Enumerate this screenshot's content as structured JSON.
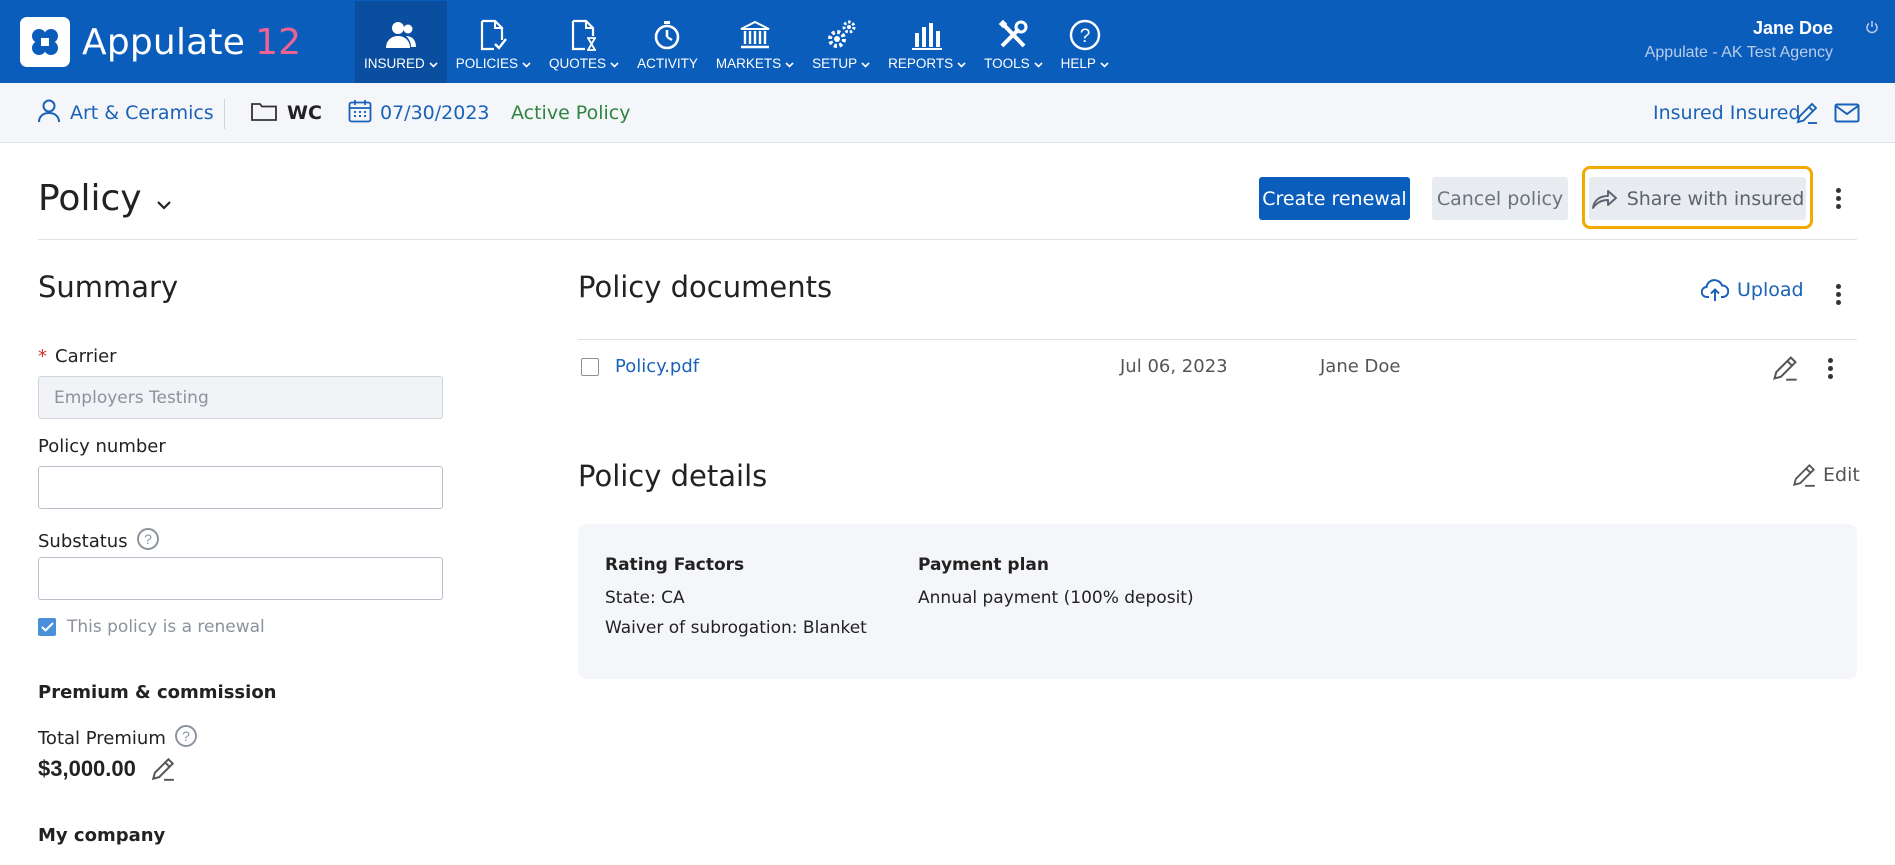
{
  "app": {
    "logo_text": "Appulate",
    "logo_version": "12",
    "brand_color": "#0b5dbb",
    "accent_color": "#f06292"
  },
  "nav": {
    "items": [
      {
        "label": "INSURED",
        "icon": "users-icon",
        "active": true
      },
      {
        "label": "POLICIES",
        "icon": "document-check-icon"
      },
      {
        "label": "QUOTES",
        "icon": "document-hourglass-icon"
      },
      {
        "label": "ACTIVITY",
        "icon": "stopwatch-icon"
      },
      {
        "label": "MARKETS",
        "icon": "bank-icon"
      },
      {
        "label": "SETUP",
        "icon": "gears-icon"
      },
      {
        "label": "REPORTS",
        "icon": "bar-chart-icon"
      },
      {
        "label": "TOOLS",
        "icon": "tools-icon"
      },
      {
        "label": "HELP",
        "icon": "help-icon"
      }
    ]
  },
  "user": {
    "name": "Jane Doe",
    "agency": "Appulate - AK Test Agency"
  },
  "subheader": {
    "insured_name": "Art & Ceramics",
    "line_of_business": "WC",
    "date": "07/30/2023",
    "status": "Active Policy",
    "insured_contact": "Insured Insured"
  },
  "page": {
    "title": "Policy",
    "create_renewal": "Create renewal",
    "cancel_policy": "Cancel policy",
    "share_with_insured": "Share with insured"
  },
  "summary": {
    "heading": "Summary",
    "carrier_label": "Carrier",
    "carrier_required_mark": "*",
    "carrier_value": "Employers Testing",
    "policy_number_label": "Policy number",
    "policy_number_value": "",
    "substatus_label": "Substatus",
    "substatus_value": "",
    "renewal_checkbox_label": "This policy is a renewal",
    "renewal_checked": true,
    "premium_section": "Premium & commission",
    "total_premium_label": "Total Premium",
    "total_premium_value": "$3,000.00",
    "my_company_label": "My company"
  },
  "documents": {
    "heading": "Policy documents",
    "upload_label": "Upload",
    "rows": [
      {
        "name": "Policy.pdf",
        "date": "Jul 06, 2023",
        "user": "Jane Doe"
      }
    ]
  },
  "details": {
    "heading": "Policy details",
    "edit_label": "Edit",
    "rating_factors_heading": "Rating Factors",
    "rating_state": "State: CA",
    "rating_waiver": "Waiver of subrogation: Blanket",
    "payment_plan_heading": "Payment plan",
    "payment_plan_value": "Annual payment (100% deposit)"
  }
}
